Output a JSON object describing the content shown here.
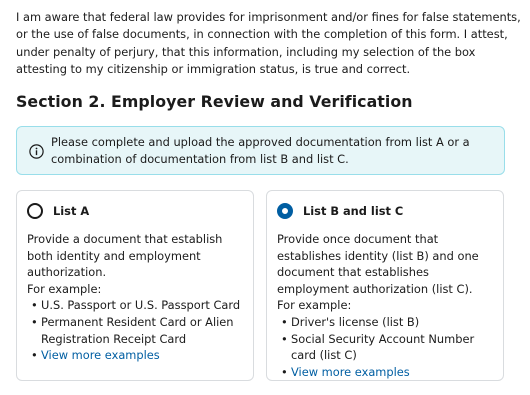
{
  "attestation": {
    "text": "I am aware that federal law provides for imprisonment and/or fines for false statements, or the use of false documents, in connection with the completion of this form. I attest, under penalty of perjury, that this information, including my selection of the box attesting to my citizenship or immigration status, is true and correct."
  },
  "section": {
    "title": "Section 2. Employer Review and Verification"
  },
  "alert": {
    "icon": "info-icon",
    "text": "Please complete and upload the approved documentation from list A or a combination of documentation from list B and list C."
  },
  "options": [
    {
      "label": "List A",
      "selected": false,
      "description": "Provide a document that establish both identity and employment authorization.",
      "example_label": "For example:",
      "items": [
        "U.S. Passport or U.S. Passport Card",
        "Permanent Resident Card or Alien Registration Receipt Card"
      ],
      "more_link": "View more examples"
    },
    {
      "label": "List B and list C",
      "selected": true,
      "description": "Provide once document that establishes identity (list B) and one document that establishes employment authorization (list C).",
      "example_label": "For example:",
      "items": [
        "Driver's license (list B)",
        "Social Security Account Number card (list C)"
      ],
      "more_link": "View more examples"
    }
  ],
  "colors": {
    "accent": "#005ea2",
    "alert_bg": "#e7f6f8",
    "alert_border": "#99deea"
  }
}
